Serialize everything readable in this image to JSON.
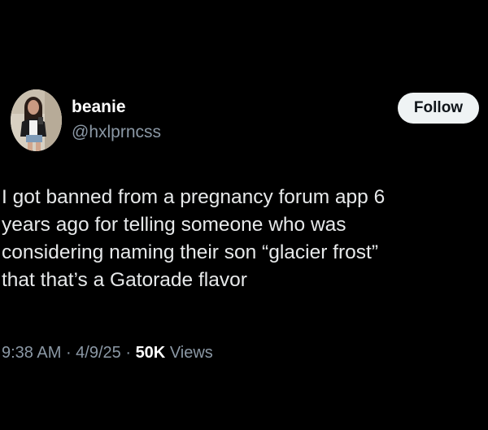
{
  "user": {
    "display_name": "beanie",
    "handle": "@hxlprncss"
  },
  "follow_button": {
    "label": "Follow"
  },
  "tweet": {
    "lines": [
      "I got banned from a pregnancy forum app 6",
      "years ago for telling someone who was",
      "considering naming their son “glacier frost”",
      "that that’s a Gatorade flavor"
    ]
  },
  "meta": {
    "time": "9:38 AM",
    "separator": " · ",
    "date": "4/9/25",
    "views_count": "50K",
    "views_label": " Views"
  },
  "colors": {
    "background": "#000000",
    "text": "#e7e9ea",
    "secondary": "#8b98a5",
    "button_bg": "#eff3f4",
    "button_text": "#0f1419"
  }
}
